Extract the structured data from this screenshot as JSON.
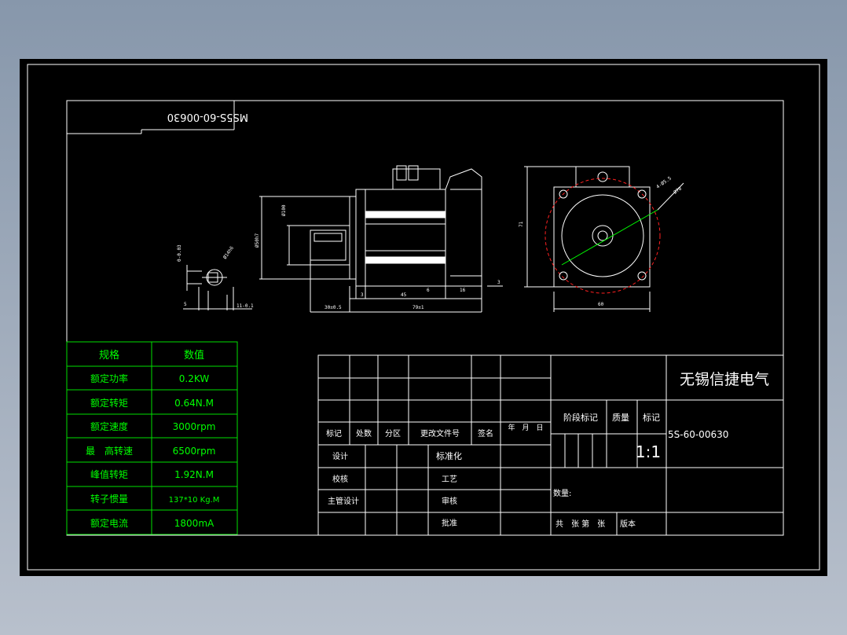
{
  "drawing": {
    "title_block": {
      "company": "无锡信捷电气",
      "drawing_no": "5S-60-00630",
      "mirrored_label": "MS5S-60-00630",
      "scale": "1:1",
      "header_cells": [
        "标记",
        "处数",
        "分区",
        "更改文件号",
        "签名",
        "年　月　日"
      ],
      "stage_headers": [
        "阶段标记",
        "质量",
        "标记"
      ],
      "rows": [
        "设计",
        "标准化",
        "校核",
        "工艺",
        "主管设计",
        "审核",
        "批准"
      ],
      "quantity_label": "数量:",
      "sheet_info": "共　张 第　张",
      "version_label": "版本"
    },
    "spec_table": {
      "headers": [
        "规格",
        "数值"
      ],
      "rows": [
        {
          "name": "额定功率",
          "value": "0.2KW"
        },
        {
          "name": "额定转矩",
          "value": "0.64N.M"
        },
        {
          "name": "额定速度",
          "value": "3000rpm"
        },
        {
          "name": "最　高转速",
          "value": "6500rpm"
        },
        {
          "name": "峰值转矩",
          "value": "1.92N.M"
        },
        {
          "name": "转子惯量",
          "value": "137*10 Kg.M"
        },
        {
          "name": "额定电流",
          "value": "1800mA"
        }
      ]
    },
    "dimensions": {
      "shaft_key": "0-0.03",
      "shaft_dia": "Ø14h6",
      "shaft_5": "5",
      "shaft_11": "11-0.1",
      "flange_dia": "Ø50h7",
      "body_dia": "Ø100",
      "len_30": "30±0.5",
      "len_3": "3",
      "len_45": "45",
      "len_6": "6",
      "len_16": "16",
      "len_total": "79±1",
      "side_3": "3",
      "holes": "4-Ø5.5",
      "pcd": "Ø70",
      "height_71": "71",
      "width_60": "60"
    }
  }
}
